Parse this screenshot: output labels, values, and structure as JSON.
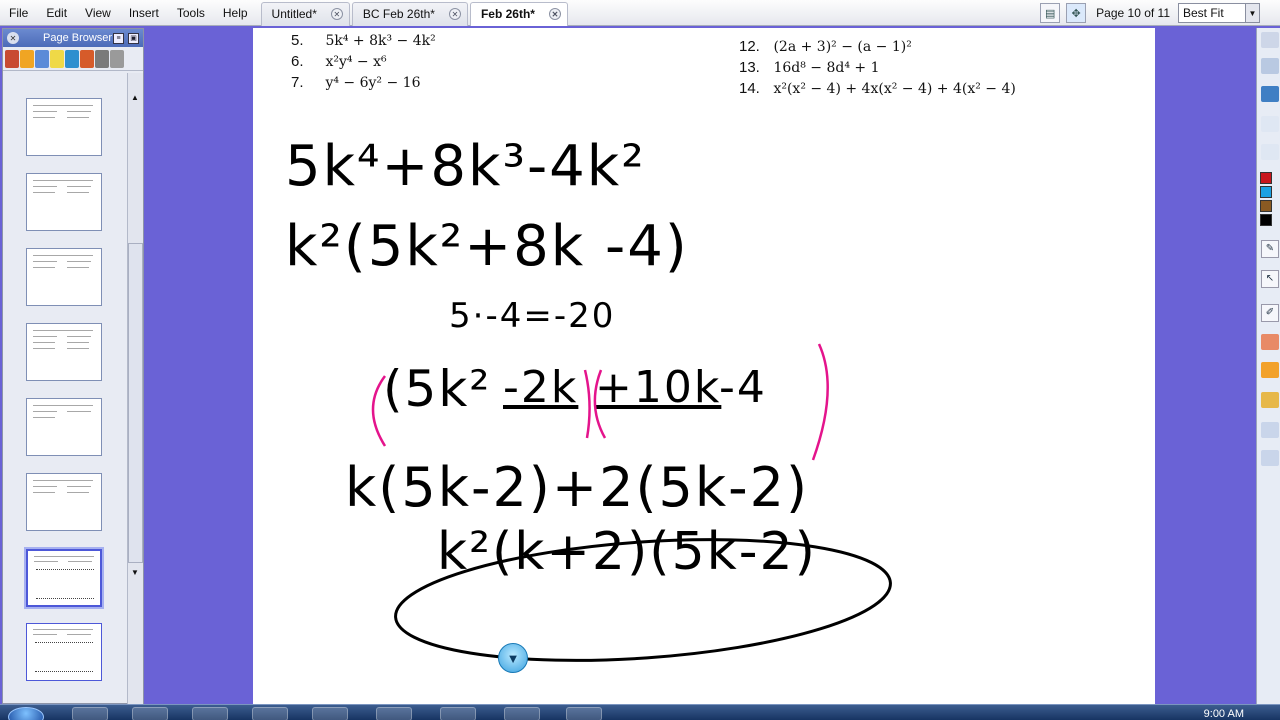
{
  "menu": {
    "items": [
      "File",
      "Edit",
      "View",
      "Insert",
      "Tools",
      "Help"
    ]
  },
  "tabs": [
    {
      "label": "Untitled*",
      "active": false
    },
    {
      "label": "BC Feb 26th*",
      "active": false
    },
    {
      "label": "Feb 26th*",
      "active": true
    }
  ],
  "toolbar": {
    "page_indicator": "Page 10 of 11",
    "fit_value": "Best Fit",
    "view_icon": "page-view-icon",
    "screen_icon": "full-screen-icon"
  },
  "page_browser": {
    "title": "Page Browser",
    "thumbnail_count": 8,
    "selected_index": 6
  },
  "problems": {
    "p5": {
      "num": "5.",
      "expr": "5k⁴ + 8k³ − 4k²"
    },
    "p6": {
      "num": "6.",
      "expr": "x²y⁴ − x⁶"
    },
    "p7": {
      "num": "7.",
      "expr": "y⁴ − 6y² − 16"
    },
    "p12": {
      "num": "12.",
      "expr": "(2a + 3)² − (a − 1)²"
    },
    "p13": {
      "num": "13.",
      "expr": "16d⁸ − 8d⁴ + 1"
    },
    "p14": {
      "num": "14.",
      "expr": "x²(x² − 4) + 4x(x² − 4) + 4(x² − 4)"
    }
  },
  "ink": {
    "line1": "5k⁴+8k³-4k²",
    "line2": "k²(5k²+8k -4)",
    "line3": "5·-4=-20",
    "line4a": "(5k²",
    "line4b": "-2k",
    "line4c": "+10k",
    "line4d": "-4",
    "line5": "k(5k-2)+2(5k-2)",
    "line6": "k²(k+2)(5k-2)"
  },
  "colors": {
    "workspace_bg": "#6a62d6",
    "ink_black": "#000000",
    "ink_pink": "#e4148c"
  },
  "taskbar": {
    "clock": "9:00 AM",
    "tray": ""
  }
}
